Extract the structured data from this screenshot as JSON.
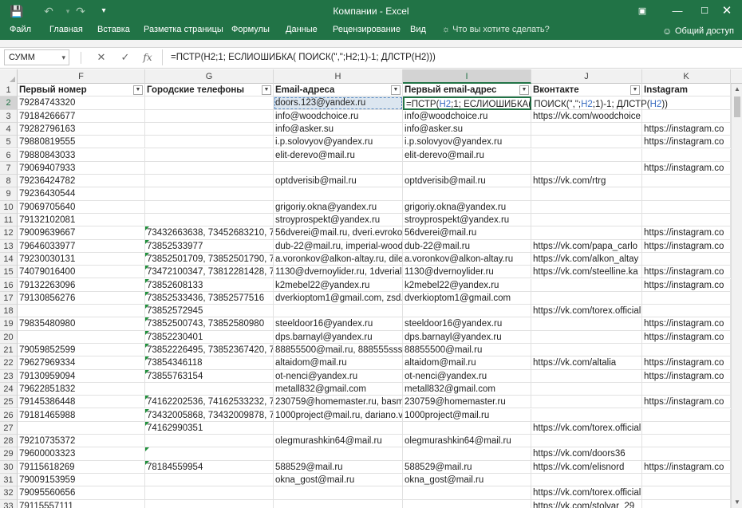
{
  "window": {
    "title": "Компании - Excel",
    "accent": "#217346"
  },
  "ribbon": {
    "tabs": [
      "Файл",
      "Главная",
      "Вставка",
      "Разметка страницы",
      "Формулы",
      "Данные",
      "Рецензирование",
      "Вид"
    ],
    "tell_me": "Что вы хотите сделать?",
    "share": "Общий доступ"
  },
  "formula_bar": {
    "name_box": "СУММ",
    "formula": "=ПСТР(H2;1; ЕСЛИОШИБКА( ПОИСК(\",\";H2;1)-1; ДЛСТР(H2)))",
    "edit_prefix": "=ПСТР(",
    "edit_ref1": "H2",
    "edit_mid1": ";1; ЕСЛИОШИБКА( ПОИСК(\",\";",
    "edit_ref2": "H2",
    "edit_mid2": ";1)-1; ДЛСТР(",
    "edit_ref3": "H2",
    "edit_suffix": "))"
  },
  "columns": [
    "F",
    "G",
    "H",
    "I",
    "J",
    "K"
  ],
  "selected_column": "I",
  "headers": {
    "F": "Первый номер",
    "G": "Городские телефоны",
    "H": "Email-адреса",
    "I": "Первый email-адрес",
    "J": "Вконтакте",
    "K": "Instagram"
  },
  "selected_row": "2",
  "rows": [
    {
      "n": "2",
      "F": "79284743320",
      "G": "",
      "H": "doors.123@yandex.ru",
      "I": "",
      "J": "",
      "K": ""
    },
    {
      "n": "3",
      "F": "79184266677",
      "G": "",
      "H": "info@woodchoice.ru",
      "I": "info@woodchoice.ru",
      "J": "https://vk.com/woodchoice",
      "K": ""
    },
    {
      "n": "4",
      "F": "79282796163",
      "G": "",
      "H": "info@asker.su",
      "I": "info@asker.su",
      "J": "",
      "K": "https://instagram.co"
    },
    {
      "n": "5",
      "F": "79880819555",
      "G": "",
      "H": "i.p.solovyov@yandex.ru",
      "I": "i.p.solovyov@yandex.ru",
      "J": "",
      "K": "https://instagram.co"
    },
    {
      "n": "6",
      "F": "79880843033",
      "G": "",
      "H": "elit-derevo@mail.ru",
      "I": "elit-derevo@mail.ru",
      "J": "",
      "K": ""
    },
    {
      "n": "7",
      "F": "79069407933",
      "G": "",
      "H": "",
      "I": "",
      "J": "",
      "K": "https://instagram.co"
    },
    {
      "n": "8",
      "F": "79236424782",
      "G": "",
      "H": "optdverisib@mail.ru",
      "I": "optdverisib@mail.ru",
      "J": "https://vk.com/rtrg",
      "K": ""
    },
    {
      "n": "9",
      "F": "79236430544",
      "G": "",
      "H": "",
      "I": "",
      "J": "",
      "K": ""
    },
    {
      "n": "10",
      "F": "79069705640",
      "G": "",
      "H": "grigoriy.okna@yandex.ru",
      "I": "grigoriy.okna@yandex.ru",
      "J": "",
      "K": ""
    },
    {
      "n": "11",
      "F": "79132102081",
      "G": "",
      "H": "stroyprospekt@yandex.ru",
      "I": "stroyprospekt@yandex.ru",
      "J": "",
      "K": ""
    },
    {
      "n": "12",
      "F": "79009639667",
      "G": "73432663638, 73452683210, 7812",
      "H": "56dverei@mail.ru, dveri.evroko",
      "I": "56dverei@mail.ru",
      "J": "",
      "K": "https://instagram.co"
    },
    {
      "n": "13",
      "F": "79646033977",
      "G": "73852533977",
      "H": "dub-22@mail.ru, imperial-wood",
      "I": "dub-22@mail.ru",
      "J": "https://vk.com/papa_carlo",
      "K": "https://instagram.co"
    },
    {
      "n": "14",
      "F": "79230030131",
      "G": "73852501709, 73852501790, 7385",
      "H": "a.voronkov@alkon-altay.ru, dile",
      "I": "a.voronkov@alkon-altay.ru",
      "J": "https://vk.com/alkon_altay",
      "K": ""
    },
    {
      "n": "15",
      "F": "74079016400",
      "G": "73472100347, 73812281428, 7381",
      "H": "1130@dvernoylider.ru, 1dverial",
      "I": "1130@dvernoylider.ru",
      "J": "https://vk.com/steelline.ka",
      "K": "https://instagram.co"
    },
    {
      "n": "16",
      "F": "79132263096",
      "G": "73852608133",
      "H": "k2mebel22@yandex.ru",
      "I": "k2mebel22@yandex.ru",
      "J": "",
      "K": "https://instagram.co"
    },
    {
      "n": "17",
      "F": "79130856276",
      "G": "73852533436, 73852577516",
      "H": "dverkioptom1@gmail.com, zsd.",
      "I": "dverkioptom1@gmail.com",
      "J": "",
      "K": ""
    },
    {
      "n": "18",
      "F": "",
      "G": "73852572945",
      "H": "",
      "I": "",
      "J": "https://vk.com/torex.official",
      "K": ""
    },
    {
      "n": "19",
      "F": "79835480980",
      "G": "73852500743, 73852580980",
      "H": "steeldoor16@yandex.ru",
      "I": "steeldoor16@yandex.ru",
      "J": "",
      "K": "https://instagram.co"
    },
    {
      "n": "20",
      "F": "",
      "G": "73852230401",
      "H": "dps.barnayl@yandex.ru",
      "I": "dps.barnayl@yandex.ru",
      "J": "",
      "K": "https://instagram.co"
    },
    {
      "n": "21",
      "F": "79059852599",
      "G": "73852226495, 73852367420, 7385",
      "H": "88855500@mail.ru, 888555sss@",
      "I": "88855500@mail.ru",
      "J": "",
      "K": ""
    },
    {
      "n": "22",
      "F": "79627969334",
      "G": "73854346118",
      "H": "altaidom@mail.ru",
      "I": "altaidom@mail.ru",
      "J": "https://vk.com/altalia",
      "K": "https://instagram.co"
    },
    {
      "n": "23",
      "F": "79130959094",
      "G": "73855763154",
      "H": "ot-nenci@yandex.ru",
      "I": "ot-nenci@yandex.ru",
      "J": "",
      "K": "https://instagram.co"
    },
    {
      "n": "24",
      "F": "79622851832",
      "G": "",
      "H": "metall832@gmail.com",
      "I": "metall832@gmail.com",
      "J": "",
      "K": ""
    },
    {
      "n": "25",
      "F": "79145386448",
      "G": "74162202536, 74162533232, 7416",
      "H": "230759@homemaster.ru, basma",
      "I": "230759@homemaster.ru",
      "J": "",
      "K": "https://instagram.co"
    },
    {
      "n": "26",
      "F": "79181465988",
      "G": "73432005868, 73432009878, 7416",
      "H": "1000project@mail.ru, dariano.v",
      "I": "1000project@mail.ru",
      "J": "",
      "K": ""
    },
    {
      "n": "27",
      "F": "",
      "G": "74162990351",
      "H": "",
      "I": "",
      "J": "https://vk.com/torex.official",
      "K": ""
    },
    {
      "n": "28",
      "F": "79210735372",
      "G": "",
      "H": "olegmurashkin64@mail.ru",
      "I": "olegmurashkin64@mail.ru",
      "J": "",
      "K": ""
    },
    {
      "n": "29",
      "F": "79600003323",
      "G": "",
      "H": "",
      "I": "",
      "J": "https://vk.com/doors36",
      "K": ""
    },
    {
      "n": "30",
      "F": "79115618269",
      "G": "78184559954",
      "H": "588529@mail.ru",
      "I": "588529@mail.ru",
      "J": "https://vk.com/elisnord",
      "K": "https://instagram.co"
    },
    {
      "n": "31",
      "F": "79009153959",
      "G": "",
      "H": "okna_gost@mail.ru",
      "I": "okna_gost@mail.ru",
      "J": "",
      "K": ""
    },
    {
      "n": "32",
      "F": "79095560656",
      "G": "",
      "H": "",
      "I": "",
      "J": "https://vk.com/torex.official",
      "K": ""
    },
    {
      "n": "33",
      "F": "79115557111",
      "G": "",
      "H": "",
      "I": "",
      "J": "https://vk.com/stolyar_29",
      "K": ""
    }
  ],
  "green_triangle_rows": [
    "12",
    "13",
    "14",
    "15",
    "16",
    "17",
    "18",
    "19",
    "20",
    "21",
    "22",
    "23",
    "25",
    "26",
    "27",
    "29",
    "30"
  ]
}
